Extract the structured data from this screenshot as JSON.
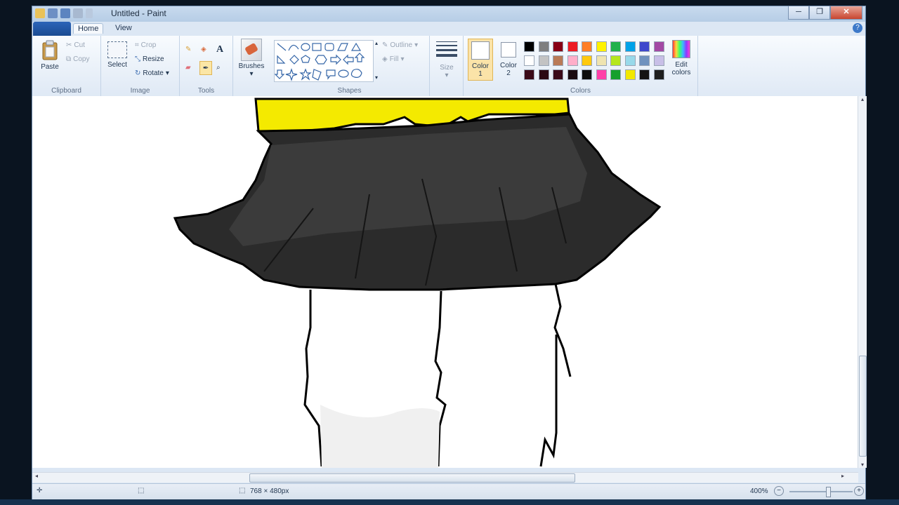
{
  "window": {
    "title": "Untitled - Paint",
    "minimize": "─",
    "maximize": "❐",
    "close": "✕"
  },
  "tabs": [
    {
      "label": "Home"
    },
    {
      "label": "View"
    }
  ],
  "help": "?",
  "clipboard": {
    "paste": "Paste",
    "cut": "Cut",
    "copy": "Copy",
    "label": "Clipboard"
  },
  "image": {
    "select": "Select",
    "crop": "Crop",
    "resize": "Resize",
    "rotate": "Rotate",
    "label": "Image"
  },
  "tools": {
    "label": "Tools",
    "text_tool": "A"
  },
  "brushes": {
    "label": "Brushes"
  },
  "shapes": {
    "label": "Shapes",
    "outline": "Outline",
    "fill": "Fill"
  },
  "size": {
    "label": "Size"
  },
  "colors": {
    "color1": "Color\n1",
    "color1_l1": "Color",
    "color1_l2": "1",
    "color2_l1": "Color",
    "color2_l2": "2",
    "edit_l1": "Edit",
    "edit_l2": "colors",
    "label": "Colors",
    "palette_row1": [
      "#000000",
      "#7f7f7f",
      "#880015",
      "#ed1c24",
      "#ff7f27",
      "#fff200",
      "#22b14c",
      "#00a2e8",
      "#3f48cc",
      "#a349a4"
    ],
    "palette_row2": [
      "#ffffff",
      "#c3c3c3",
      "#b97a57",
      "#ffaec9",
      "#ffc90e",
      "#efe4b0",
      "#b5e61d",
      "#99d9ea",
      "#7092be",
      "#c8bfe7"
    ],
    "palette_row3": [
      "#3a0a18",
      "#2a0812",
      "#3a0a1a",
      "#1a0a10",
      "#0d0d0d",
      "#ff3fa8",
      "#16a02c",
      "#f2e800",
      "#141414",
      "#1e1e1e"
    ]
  },
  "status": {
    "dimensions": "768 × 480px",
    "zoom": "400%"
  }
}
